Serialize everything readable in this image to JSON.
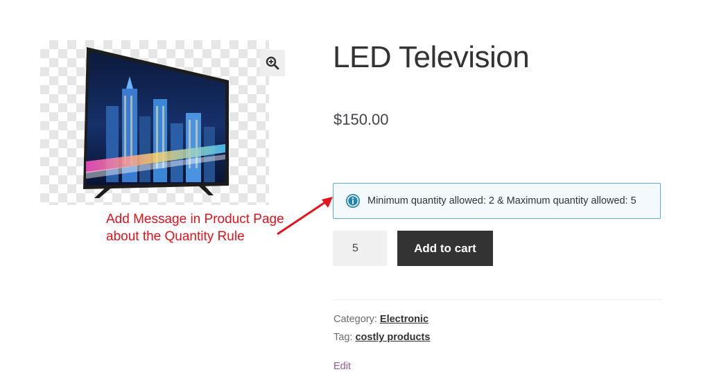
{
  "product": {
    "title": "LED Television",
    "price": "$150.00"
  },
  "notice": {
    "message": "Minimum quantity allowed: 2 & Maximum quantity allowed: 5",
    "icon": "info-icon",
    "color": "#1e85be"
  },
  "cart": {
    "quantity": "5",
    "add_label": "Add to cart"
  },
  "meta": {
    "category_label": "Category:",
    "category_value": "Electronic",
    "tag_label": "Tag:",
    "tag_value": "costly products"
  },
  "edit_label": "Edit",
  "annotation": {
    "line1": "Add Message in Product Page",
    "line2": "about the Quantity Rule",
    "color": "#e8101a"
  },
  "gallery": {
    "zoom_icon": "zoom-in-icon"
  }
}
